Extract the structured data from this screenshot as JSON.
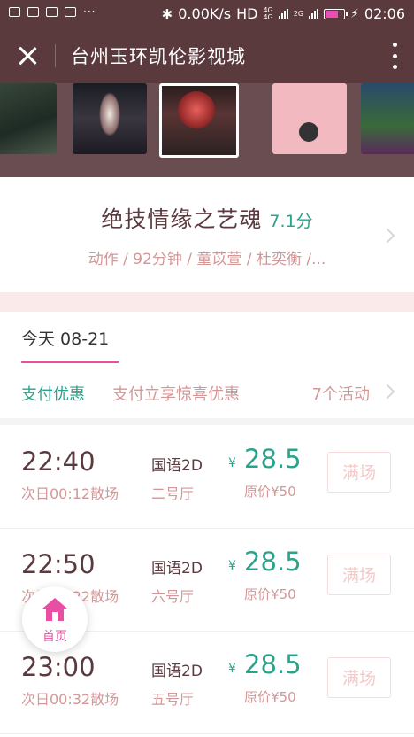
{
  "status_bar": {
    "speed": "0.00K/s",
    "hd": "HD",
    "net_top": "4G",
    "net_top2": "4G",
    "net2": "2G",
    "time": "02:06",
    "battery_fraction": 0.75,
    "battery_color": "#e94fb3"
  },
  "header": {
    "title": "台州玉环凯伦影视城",
    "close_icon": "close-icon",
    "more_icon": "more-vertical-icon"
  },
  "movie": {
    "title": "绝技情缘之艺魂",
    "score": "7.1分",
    "meta": "动作 / 92分钟 / 童苡萱 / 杜奕衡 /..."
  },
  "date_tab": "今天 08-21",
  "promo": {
    "label": "支付优惠",
    "text": "支付立享惊喜优惠",
    "count": "7个活动"
  },
  "showings": [
    {
      "start": "22:40",
      "end": "次日00:12散场",
      "lang": "国语2D",
      "hall": "二号厅",
      "currency": "¥",
      "price": "28.5",
      "orig": "原价¥50",
      "button": "满场"
    },
    {
      "start": "22:50",
      "end": "次日00:22散场",
      "lang": "国语2D",
      "hall": "六号厅",
      "currency": "¥",
      "price": "28.5",
      "orig": "原价¥50",
      "button": "满场"
    },
    {
      "start": "23:00",
      "end": "次日00:32散场",
      "lang": "国语2D",
      "hall": "五号厅",
      "currency": "¥",
      "price": "28.5",
      "orig": "原价¥50",
      "button": "满场"
    }
  ],
  "home_button": {
    "label": "首页"
  },
  "colors": {
    "header_bg": "#5b3a3e",
    "accent_green": "#2aa38b",
    "accent_pink": "#e84fa2",
    "muted_pink": "#d49797"
  }
}
